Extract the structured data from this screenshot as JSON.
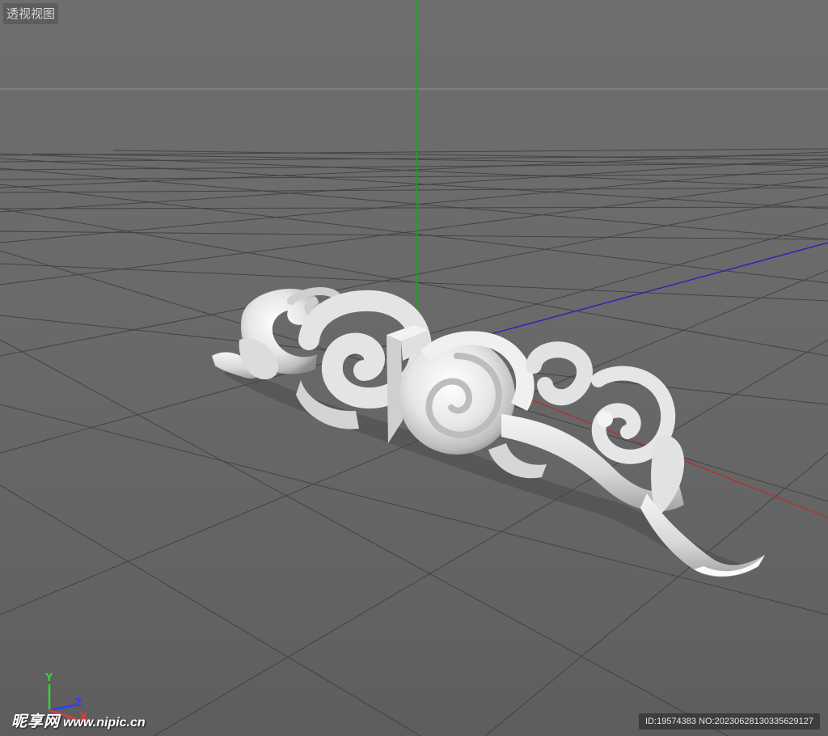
{
  "viewport": {
    "label": "透视视图"
  },
  "axis_gizmo": {
    "y_label": "Y",
    "z_label": "Z",
    "x_label": "X",
    "y_color": "#35d335",
    "z_color": "#3a3aff",
    "x_color": "#e23a3a"
  },
  "scene_axes": {
    "y_color": "#1fa11f",
    "z_color": "#2424b8",
    "x_color": "#b03030"
  },
  "model": {
    "name": "cloud-ornament",
    "color": "#e8e8e8"
  },
  "watermark": {
    "brand": "昵享网",
    "url": "www.nipic.cn",
    "id_text": "ID:19574383 NO:20230628130335629127"
  }
}
